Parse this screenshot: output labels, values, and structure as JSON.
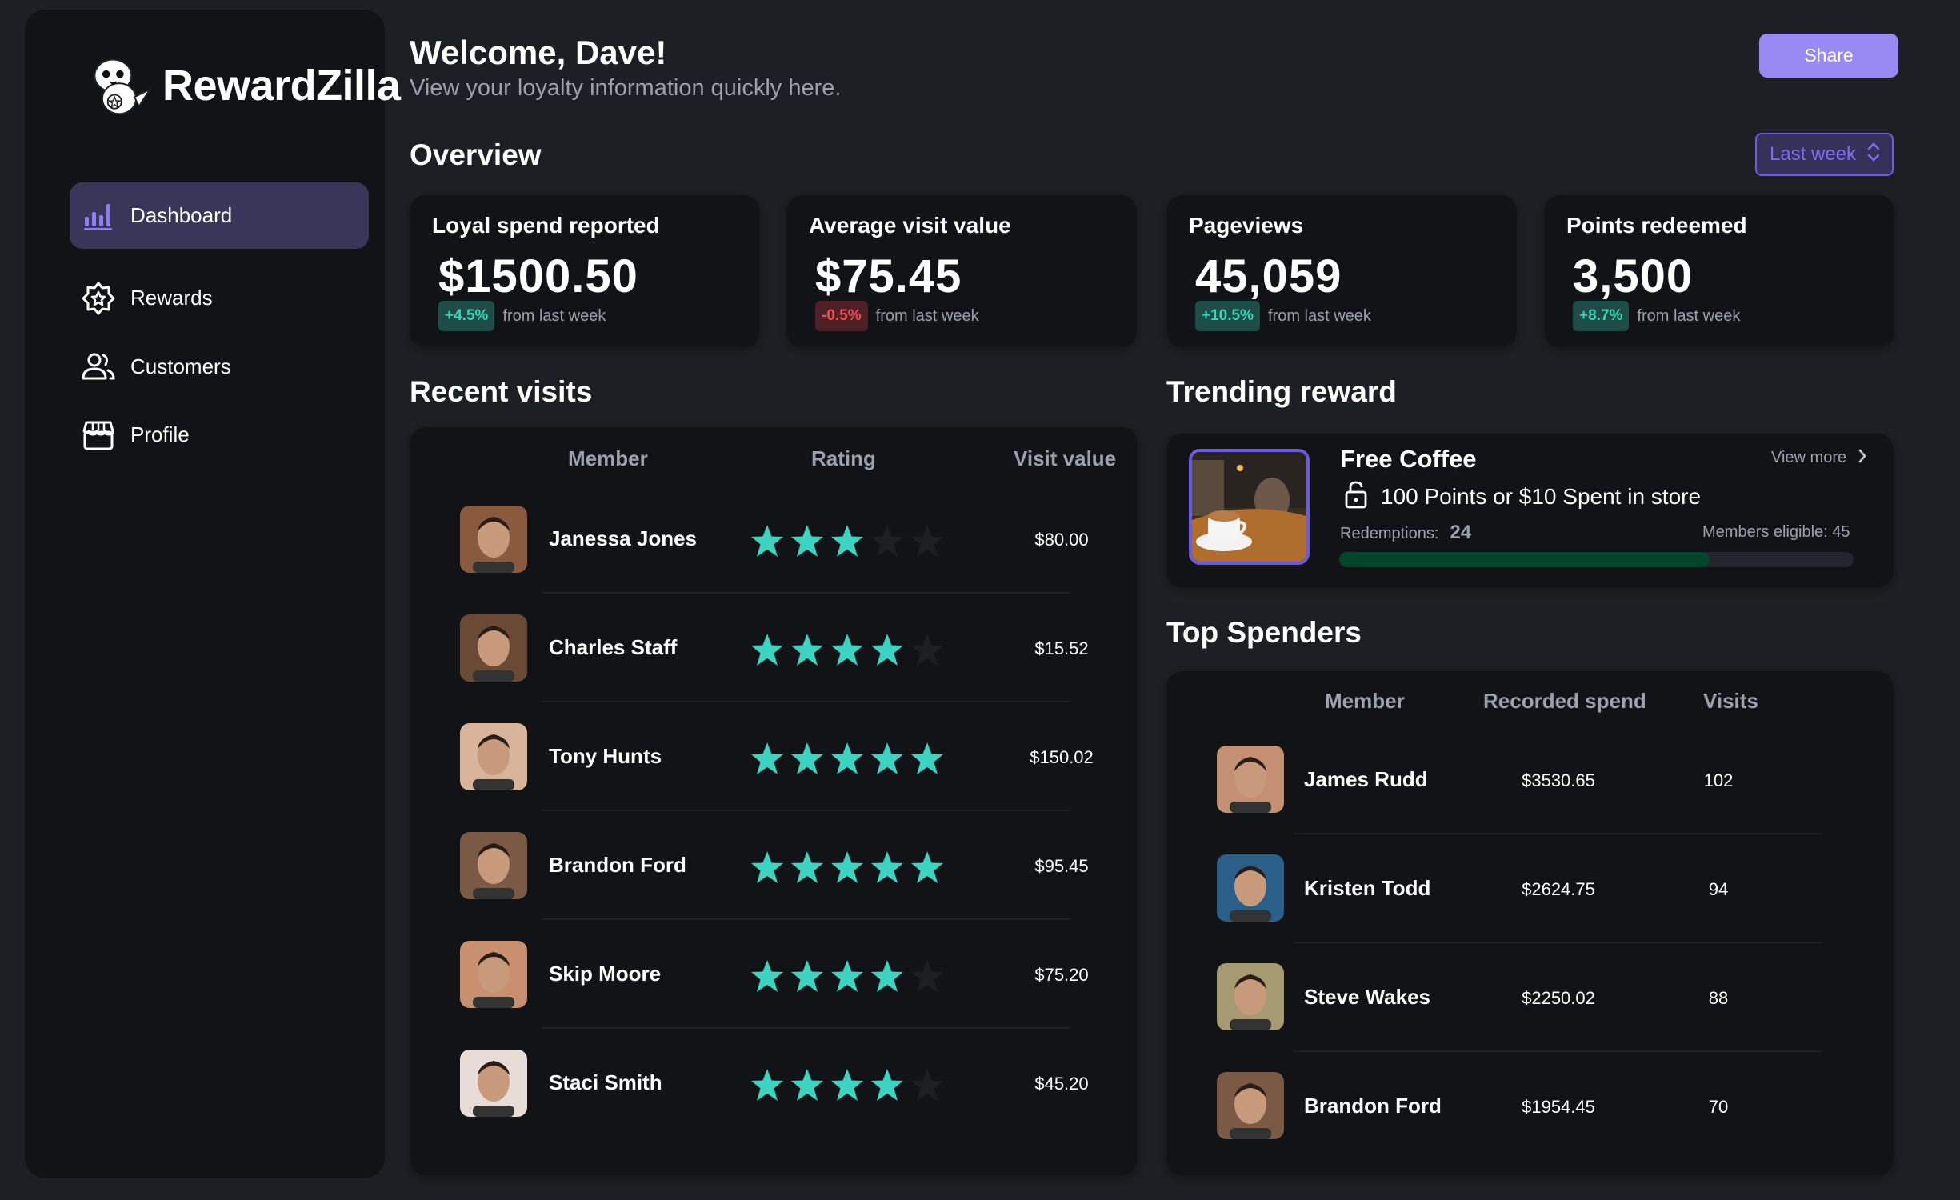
{
  "app": {
    "name": "RewardZilla"
  },
  "sidebar": {
    "items": [
      {
        "label": "Dashboard",
        "icon": "bar-chart-icon",
        "active": true
      },
      {
        "label": "Rewards",
        "icon": "star-badge-icon",
        "active": false
      },
      {
        "label": "Customers",
        "icon": "users-icon",
        "active": false
      },
      {
        "label": "Profile",
        "icon": "storefront-icon",
        "active": false
      }
    ]
  },
  "header": {
    "title": "Welcome, Dave!",
    "subtitle": "View your loyalty information quickly here.",
    "share_label": "Share"
  },
  "overview": {
    "title": "Overview",
    "range": "Last week",
    "stats": [
      {
        "label": "Loyal spend reported",
        "value": "$1500.50",
        "change": "+4.5%",
        "trend": "up",
        "suffix": "from last week"
      },
      {
        "label": "Average visit value",
        "value": "$75.45",
        "change": "-0.5%",
        "trend": "down",
        "suffix": "from last week"
      },
      {
        "label": "Pageviews",
        "value": "45,059",
        "change": "+10.5%",
        "trend": "up",
        "suffix": "from last week"
      },
      {
        "label": "Points redeemed",
        "value": "3,500",
        "change": "+8.7%",
        "trend": "up",
        "suffix": "from last week"
      }
    ]
  },
  "recent_visits": {
    "title": "Recent visits",
    "columns": [
      "Member",
      "Rating",
      "Visit value"
    ],
    "rows": [
      {
        "name": "Janessa Jones",
        "rating": 3,
        "value": "$80.00",
        "avatar_color": "#8a5a3f"
      },
      {
        "name": "Charles Staff",
        "rating": 4,
        "value": "$15.52",
        "avatar_color": "#6b4a35"
      },
      {
        "name": "Tony Hunts",
        "rating": 5,
        "value": "$150.02",
        "avatar_color": "#d8b49a"
      },
      {
        "name": "Brandon Ford",
        "rating": 5,
        "value": "$95.45",
        "avatar_color": "#7a5a45"
      },
      {
        "name": "Skip Moore",
        "rating": 4,
        "value": "$75.20",
        "avatar_color": "#c9906f"
      },
      {
        "name": "Staci Smith",
        "rating": 4,
        "value": "$45.20",
        "avatar_color": "#e8dcd6"
      }
    ],
    "max_rating": 5
  },
  "trending_reward": {
    "title": "Trending reward",
    "name": "Free Coffee",
    "requirement": "100 Points or $10 Spent in store",
    "view_more_label": "View more",
    "redemptions_label": "Redemptions:",
    "redemptions": "24",
    "eligible_label": "Members eligible: 45",
    "progress": 0.72
  },
  "top_spenders": {
    "title": "Top Spenders",
    "columns": [
      "Member",
      "Recorded spend",
      "Visits"
    ],
    "rows": [
      {
        "name": "James Rudd",
        "spend": "$3530.65",
        "visits": "102",
        "avatar_color": "#c49073"
      },
      {
        "name": "Kristen Todd",
        "spend": "$2624.75",
        "visits": "94",
        "avatar_color": "#2a5f8a"
      },
      {
        "name": "Steve Wakes",
        "spend": "$2250.02",
        "visits": "88",
        "avatar_color": "#a69a73"
      },
      {
        "name": "Brandon Ford",
        "spend": "$1954.45",
        "visits": "70",
        "avatar_color": "#7a5a45"
      }
    ]
  },
  "colors": {
    "accent": "#998af3",
    "star": "#3dd3c1",
    "star_empty": "#1d1f22",
    "positive": "#3dd3b4",
    "negative": "#f0505a"
  }
}
